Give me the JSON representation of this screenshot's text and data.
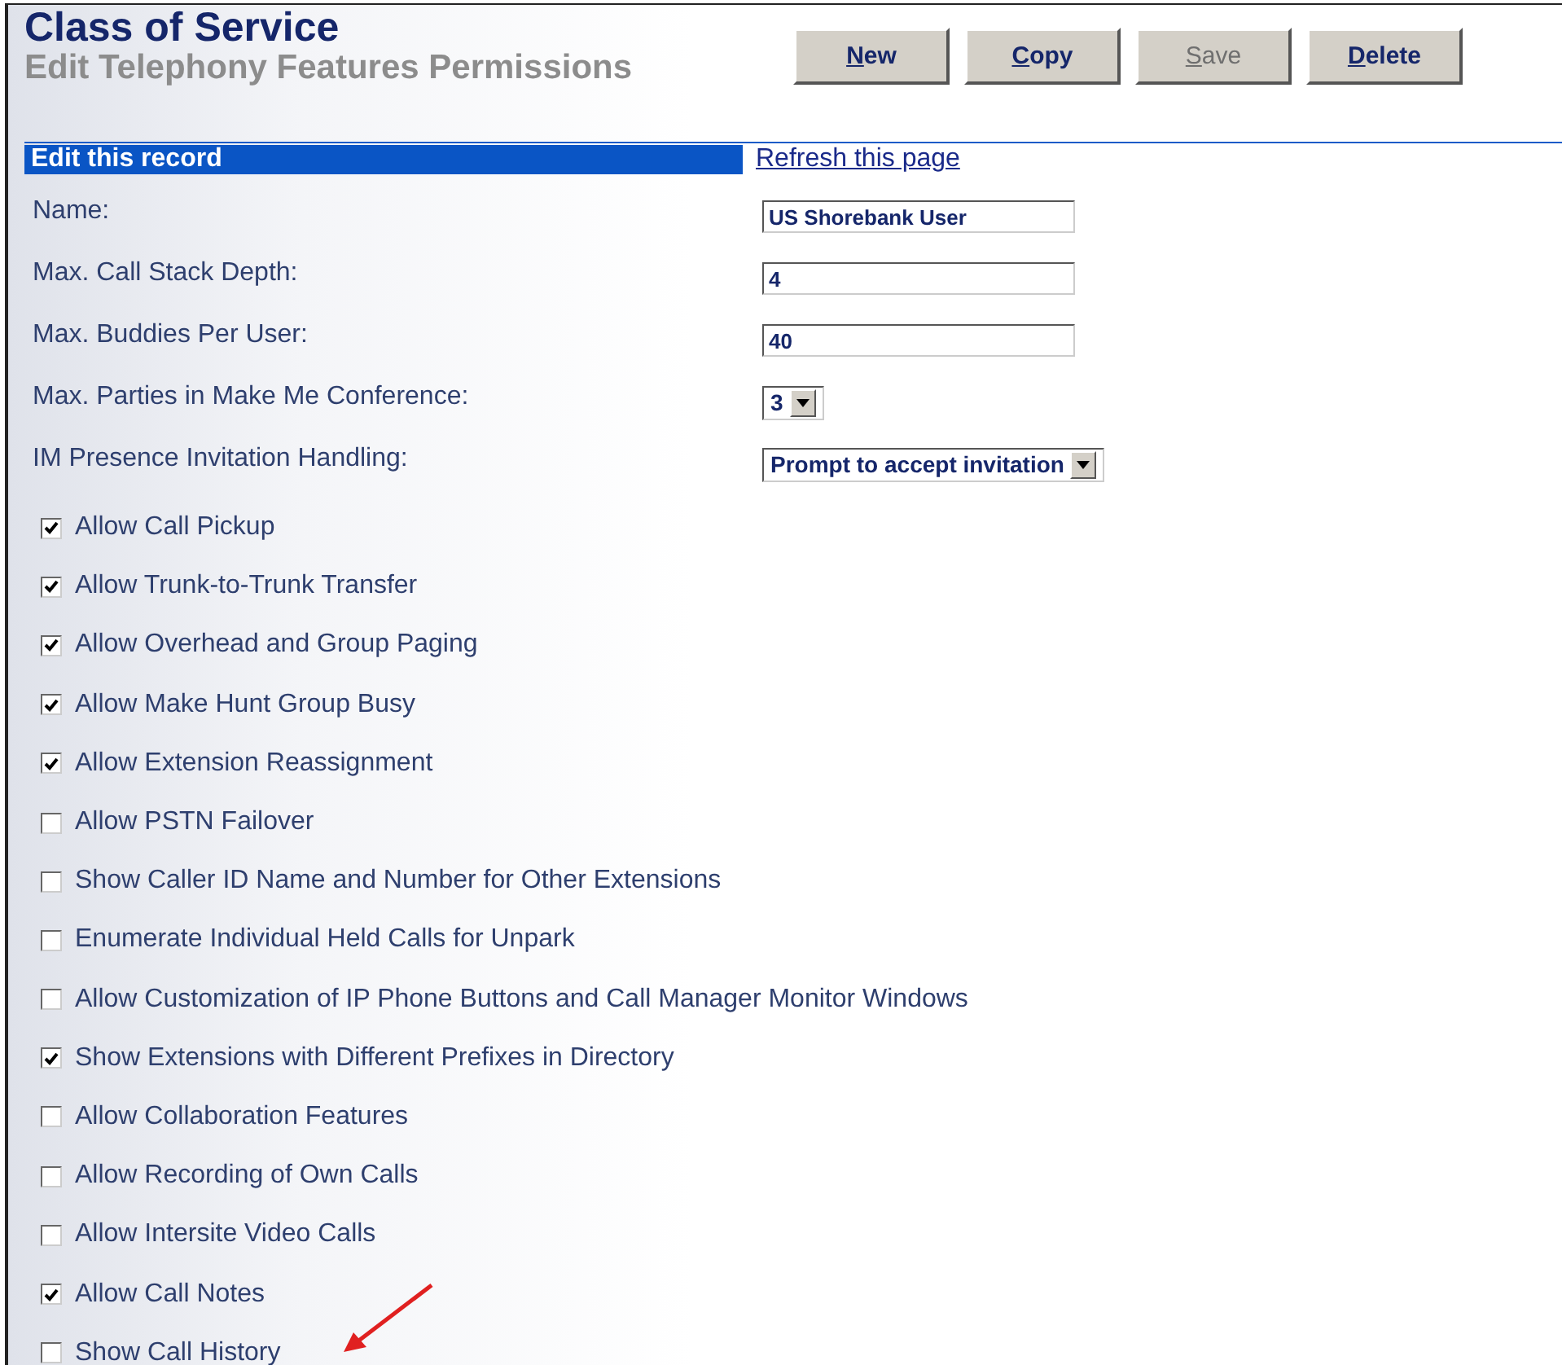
{
  "header": {
    "title": "Class of Service",
    "subtitle": "Edit Telephony Features Permissions"
  },
  "buttons": [
    {
      "label": "New",
      "disabled": false
    },
    {
      "label": "Copy",
      "disabled": false
    },
    {
      "label": "Save",
      "disabled": true
    },
    {
      "label": "Delete",
      "disabled": false
    }
  ],
  "section": {
    "title": "Edit this record",
    "link": "Refresh this page"
  },
  "fields": [
    {
      "kind": "text",
      "label": "Name:",
      "value": "US Shorebank User"
    },
    {
      "kind": "text",
      "label": "Max. Call Stack Depth:",
      "value": "4"
    },
    {
      "kind": "text",
      "label": "Max. Buddies Per User:",
      "value": "40"
    },
    {
      "kind": "select",
      "label": "Max. Parties in Make Me Conference:",
      "value": "3"
    },
    {
      "kind": "select",
      "label": "IM Presence Invitation Handling:",
      "value": "Prompt to accept invitation"
    }
  ],
  "options": [
    {
      "label": "Allow Call Pickup",
      "checked": true
    },
    {
      "label": "Allow Trunk-to-Trunk Transfer",
      "checked": true
    },
    {
      "label": "Allow Overhead and Group Paging",
      "checked": true
    },
    {
      "label": "Allow Make Hunt Group Busy",
      "checked": true
    },
    {
      "label": "Allow Extension Reassignment",
      "checked": true
    },
    {
      "label": "Allow PSTN Failover",
      "checked": false
    },
    {
      "label": "Show Caller ID Name and Number for Other Extensions",
      "checked": false
    },
    {
      "label": "Enumerate Individual Held Calls for Unpark",
      "checked": false
    },
    {
      "label": "Allow Customization of IP Phone Buttons and Call Manager Monitor Windows",
      "checked": false
    },
    {
      "label": "Show Extensions with Different Prefixes in Directory",
      "checked": true
    },
    {
      "label": "Allow Collaboration Features",
      "checked": false
    },
    {
      "label": "Allow Recording of Own Calls",
      "checked": false
    },
    {
      "label": "Allow Intersite Video Calls",
      "checked": false
    },
    {
      "label": "Allow Call Notes",
      "checked": true
    },
    {
      "label": "Show Call History",
      "checked": false
    }
  ]
}
